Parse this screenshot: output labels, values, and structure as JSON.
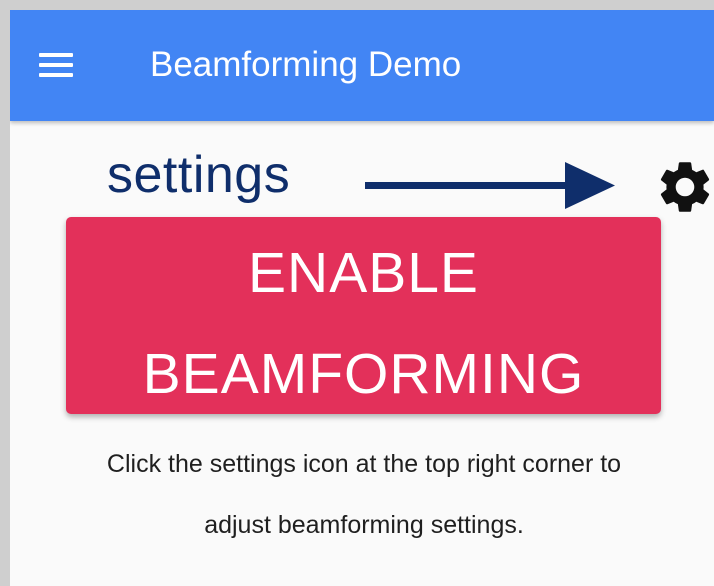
{
  "app_bar": {
    "title": "Beamforming Demo",
    "background_color": "#4285f4",
    "menu_icon": "hamburger-menu-icon"
  },
  "annotation": {
    "label": "settings",
    "arrow_icon": "right-arrow-icon",
    "color": "#0f2e6b"
  },
  "settings_button": {
    "icon": "gear-icon"
  },
  "enable_button": {
    "line1": "ENABLE",
    "line2": "BEAMFORMING",
    "color": "#e3305a"
  },
  "help": {
    "line1": "Click the settings icon at the top right corner to",
    "line2": "adjust beamforming settings."
  }
}
